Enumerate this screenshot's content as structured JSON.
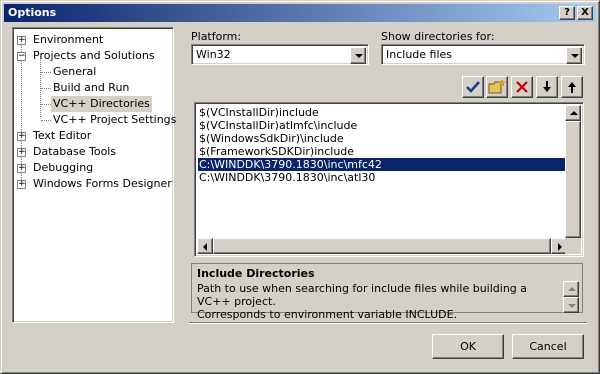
{
  "window": {
    "title": "Options"
  },
  "caption_buttons": {
    "help": "?",
    "close": "X"
  },
  "tree": {
    "items": [
      {
        "label": "Environment",
        "expander": "+"
      },
      {
        "label": "Projects and Solutions",
        "expander": "−"
      },
      {
        "label": "General"
      },
      {
        "label": "Build and Run"
      },
      {
        "label": "VC++ Directories"
      },
      {
        "label": "VC++ Project Settings"
      },
      {
        "label": "Text Editor",
        "expander": "+"
      },
      {
        "label": "Database Tools",
        "expander": "+"
      },
      {
        "label": "Debugging",
        "expander": "+"
      },
      {
        "label": "Windows Forms Designer",
        "expander": "+"
      }
    ],
    "selected": "VC++ Directories"
  },
  "platform": {
    "label": "Platform:",
    "value": "Win32"
  },
  "show_dirs": {
    "label": "Show directories for:",
    "value": "Include files"
  },
  "toolbar": {
    "check_icon": "check-icon",
    "new_folder_icon": "new-folder-icon",
    "delete_icon": "delete-icon",
    "move_down_icon": "arrow-down-icon",
    "move_up_icon": "arrow-up-icon"
  },
  "directories": {
    "rows": [
      "$(VCInstallDir)include",
      "$(VCInstallDir)atlmfc\\include",
      "$(WindowsSdkDir)\\include",
      "$(FrameworkSDKDir)include",
      "C:\\WINDDK\\3790.1830\\inc\\mfc42",
      "C:\\WINDDK\\3790.1830\\inc\\atl30"
    ],
    "selected_index": 4
  },
  "description": {
    "title": "Include Directories",
    "line1": "Path to use when searching for include files while building a VC++ project.",
    "line2": "Corresponds to environment variable INCLUDE."
  },
  "buttons": {
    "ok": "OK",
    "cancel": "Cancel"
  },
  "colors": {
    "title_bar": "#0a246a",
    "selection": "#0a246a",
    "dialog": "#d4d0c8"
  }
}
